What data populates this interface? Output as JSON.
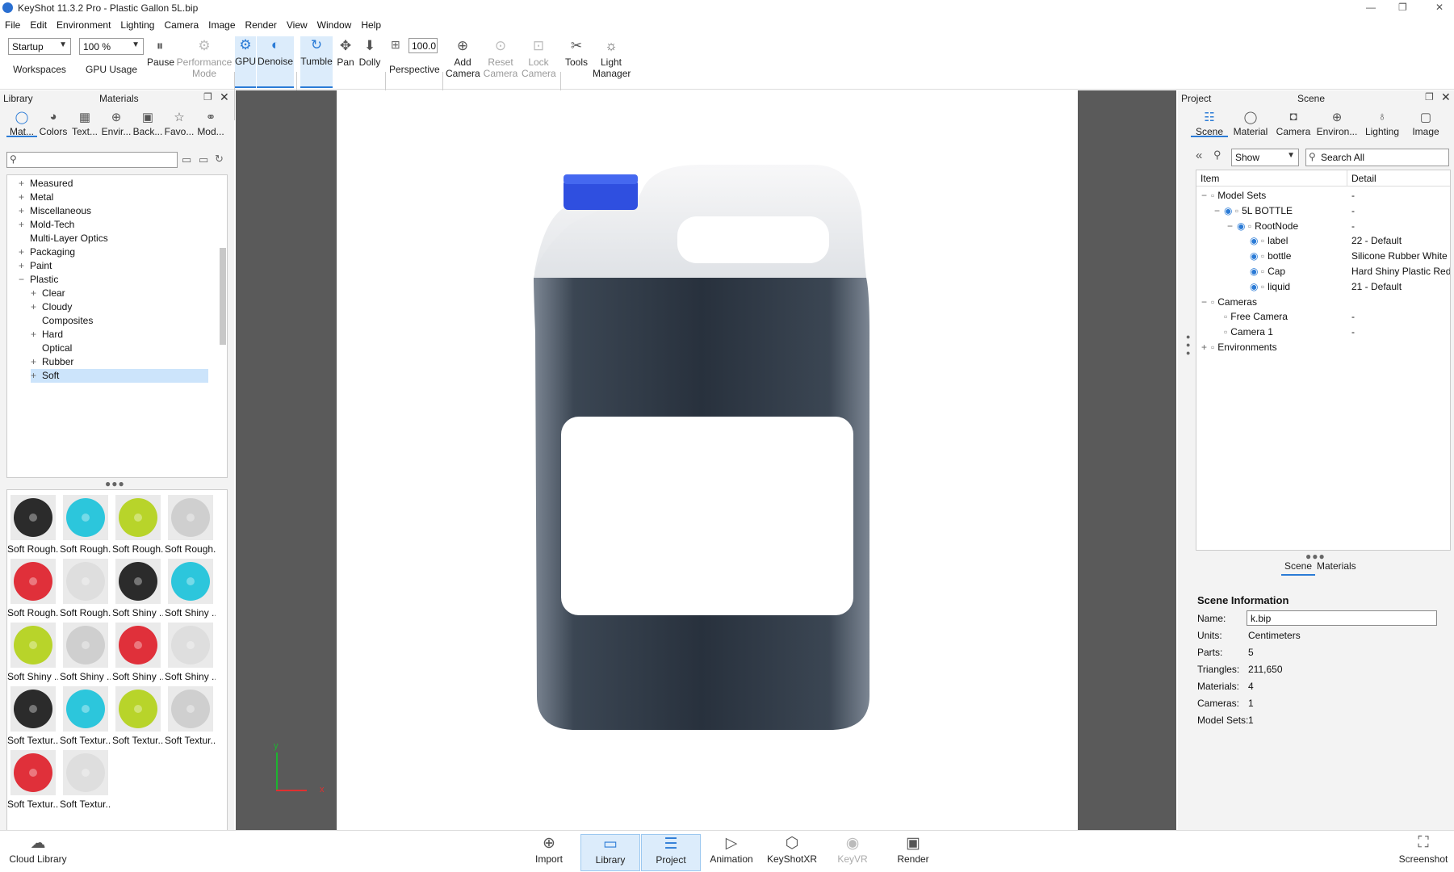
{
  "window": {
    "title": "KeyShot 11.3.2 Pro  - Plastic Gallon 5L.bip",
    "min": "—",
    "max": "❐",
    "close": "✕"
  },
  "menu": [
    "File",
    "Edit",
    "Environment",
    "Lighting",
    "Camera",
    "Image",
    "Render",
    "View",
    "Window",
    "Help"
  ],
  "toolbar": {
    "workspace_value": "Startup",
    "workspaces_label": "Workspaces",
    "gpu_usage_value": "100 %",
    "gpu_usage_label": "GPU Usage",
    "pause": "Pause",
    "performance_mode": "Performance Mode",
    "gpu": "GPU",
    "denoise": "Denoise",
    "tumble": "Tumble",
    "pan": "Pan",
    "dolly": "Dolly",
    "perspective_value": "100.0",
    "perspective": "Perspective",
    "add_camera": "Add Camera",
    "reset_camera": "Reset Camera",
    "lock_camera": "Lock Camera",
    "tools": "Tools",
    "light_manager": "Light Manager"
  },
  "library": {
    "title": "Library",
    "subtitle": "Materials",
    "tabs": [
      "Mat...",
      "Colors",
      "Text...",
      "Envir...",
      "Back...",
      "Favo...",
      "Mod..."
    ],
    "tree": [
      {
        "label": "Measured",
        "pm": "+",
        "indent": 0
      },
      {
        "label": "Metal",
        "pm": "+",
        "indent": 0
      },
      {
        "label": "Miscellaneous",
        "pm": "+",
        "indent": 0
      },
      {
        "label": "Mold-Tech",
        "pm": "+",
        "indent": 0
      },
      {
        "label": "Multi-Layer Optics",
        "pm": "",
        "indent": 0
      },
      {
        "label": "Packaging",
        "pm": "+",
        "indent": 0
      },
      {
        "label": "Paint",
        "pm": "+",
        "indent": 0
      },
      {
        "label": "Plastic",
        "pm": "−",
        "indent": 0
      },
      {
        "label": "Clear",
        "pm": "+",
        "indent": 1
      },
      {
        "label": "Cloudy",
        "pm": "+",
        "indent": 1
      },
      {
        "label": "Composites",
        "pm": "",
        "indent": 1
      },
      {
        "label": "Hard",
        "pm": "+",
        "indent": 1
      },
      {
        "label": "Optical",
        "pm": "",
        "indent": 1
      },
      {
        "label": "Rubber",
        "pm": "+",
        "indent": 1
      },
      {
        "label": "Soft",
        "pm": "+",
        "indent": 1,
        "selected": true
      }
    ],
    "materials": [
      {
        "label": "Soft Rough...",
        "color": "#2b2b2b"
      },
      {
        "label": "Soft Rough...",
        "color": "#2cc6dc"
      },
      {
        "label": "Soft Rough...",
        "color": "#b8d42a"
      },
      {
        "label": "Soft Rough...",
        "color": "#cfcfcf"
      },
      {
        "label": "Soft Rough...",
        "color": "#e0303a"
      },
      {
        "label": "Soft Rough...",
        "color": "#dedede"
      },
      {
        "label": "Soft Shiny ...",
        "color": "#2b2b2b"
      },
      {
        "label": "Soft Shiny ...",
        "color": "#2cc6dc"
      },
      {
        "label": "Soft Shiny ...",
        "color": "#b8d42a"
      },
      {
        "label": "Soft Shiny ...",
        "color": "#cfcfcf"
      },
      {
        "label": "Soft Shiny ...",
        "color": "#e0303a"
      },
      {
        "label": "Soft Shiny ...",
        "color": "#dedede"
      },
      {
        "label": "Soft Textur...",
        "color": "#2b2b2b"
      },
      {
        "label": "Soft Textur...",
        "color": "#2cc6dc"
      },
      {
        "label": "Soft Textur...",
        "color": "#b8d42a"
      },
      {
        "label": "Soft Textur...",
        "color": "#cfcfcf"
      },
      {
        "label": "Soft Textur...",
        "color": "#e0303a"
      },
      {
        "label": "Soft Textur...",
        "color": "#dedede"
      }
    ]
  },
  "viewport": {
    "axis_y": "y",
    "axis_x": "x"
  },
  "project": {
    "title": "Project",
    "subtitle": "Scene",
    "tabs": [
      "Scene",
      "Material",
      "Camera",
      "Environ...",
      "Lighting",
      "Image"
    ],
    "show_value": "Show",
    "search_placeholder": "Search All",
    "col_item": "Item",
    "col_detail": "Detail",
    "rows": [
      {
        "label": "Model Sets",
        "detail": "-",
        "indent": 0,
        "pm": "−",
        "eye": false
      },
      {
        "label": "5L BOTTLE",
        "detail": "-",
        "indent": 1,
        "pm": "−",
        "eye": true
      },
      {
        "label": "RootNode",
        "detail": "-",
        "indent": 2,
        "pm": "−",
        "eye": true
      },
      {
        "label": "label",
        "detail": "22 - Default",
        "indent": 3,
        "pm": "",
        "eye": true
      },
      {
        "label": "bottle",
        "detail": "Silicone Rubber White ...",
        "indent": 3,
        "pm": "",
        "eye": true
      },
      {
        "label": "Cap",
        "detail": "Hard Shiny Plastic Red...",
        "indent": 3,
        "pm": "",
        "eye": true
      },
      {
        "label": "liquid",
        "detail": "21 - Default",
        "indent": 3,
        "pm": "",
        "eye": true
      },
      {
        "label": "Cameras",
        "detail": "",
        "indent": 0,
        "pm": "−",
        "eye": false
      },
      {
        "label": "Free Camera",
        "detail": "-",
        "indent": 1,
        "pm": "",
        "eye": false
      },
      {
        "label": "Camera 1",
        "detail": "-",
        "indent": 1,
        "pm": "",
        "eye": false
      },
      {
        "label": "Environments",
        "detail": "",
        "indent": 0,
        "pm": "+",
        "eye": false
      }
    ],
    "subtabs": {
      "scene": "Scene",
      "materials": "Materials"
    },
    "info": {
      "heading": "Scene Information",
      "name_label": "Name:",
      "name_value": "k.bip",
      "units_label": "Units:",
      "units_value": "Centimeters",
      "parts_label": "Parts:",
      "parts_value": "5",
      "triangles_label": "Triangles:",
      "triangles_value": "211,650",
      "materials_label": "Materials:",
      "materials_value": "4",
      "cameras_label": "Cameras:",
      "cameras_value": "1",
      "modelsets_label": "Model Sets:",
      "modelsets_value": "1"
    }
  },
  "bottom": {
    "cloud_library": "Cloud Library",
    "import": "Import",
    "library": "Library",
    "project": "Project",
    "animation": "Animation",
    "keyshotxr": "KeyShotXR",
    "keyvr": "KeyVR",
    "render": "Render",
    "screenshot": "Screenshot"
  },
  "colors": {
    "accent": "#2b7bd6",
    "cap": "#2f4fe0",
    "liquid": "#2b3440"
  }
}
